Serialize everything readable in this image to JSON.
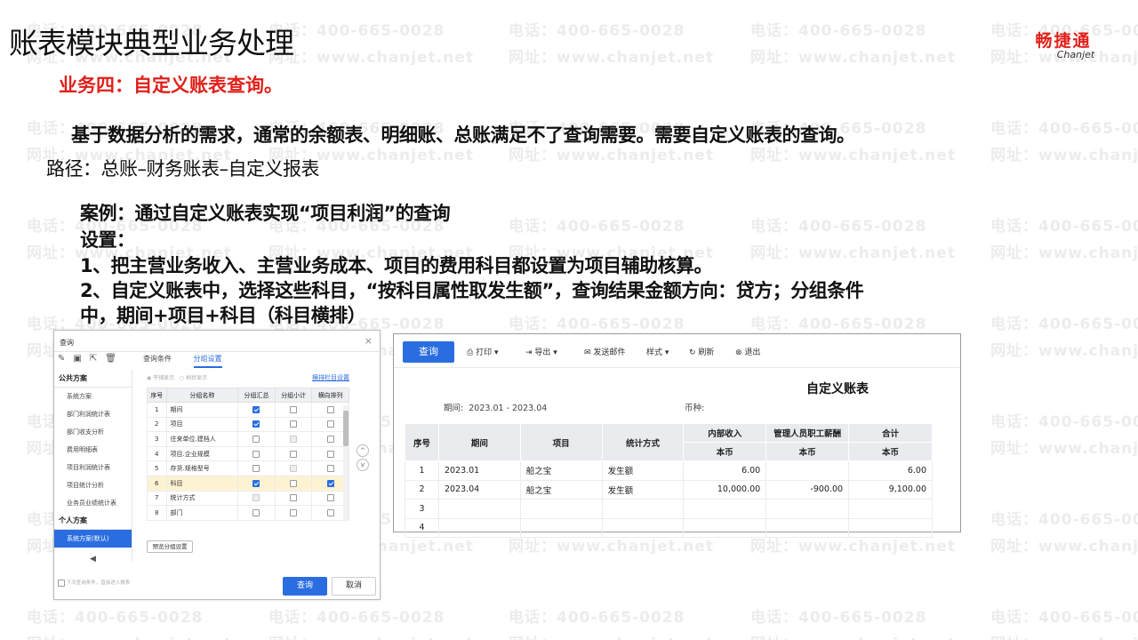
{
  "slide": {
    "title": "账表模块典型业务处理",
    "logo_cn": "畅捷通",
    "logo_en": "Chanjet",
    "section": "业务四：自定义账表查询。",
    "intro": "基于数据分析的需求，通常的余额表、明细账、总账满足不了查询需要。需要自定义账表的查询。",
    "path": "路径：总账–财务账表–自定义报表",
    "case": "案例：通过自定义账表实现“项目利润”的查询",
    "settings": "设置：",
    "step1": "1、把主营业务收入、主营业务成本、项目的费用科目都设置为项目辅助核算。",
    "step2a": "2、自定义账表中，选择这些科目，“按科目属性取发生额”，查询结果金额方向：贷方；分组条件",
    "step2b": "中，期间+项目+科目（科目横排）",
    "watermark_phone": "电话：400-665-0028",
    "watermark_site": "网址：www.chanjet.net"
  },
  "dialog": {
    "title": "查询",
    "close": "×",
    "sidebar": [
      {
        "label": "公共方案",
        "type": "group"
      },
      {
        "label": "系统方案",
        "type": "item"
      },
      {
        "label": "部门利润统计表",
        "type": "item"
      },
      {
        "label": "部门收支分析",
        "type": "item"
      },
      {
        "label": "费用明细表",
        "type": "item"
      },
      {
        "label": "项目利润统计表",
        "type": "item"
      },
      {
        "label": "项目统计分析",
        "type": "item"
      },
      {
        "label": "业务员业绩统计表",
        "type": "item"
      },
      {
        "label": "个人方案",
        "type": "group"
      },
      {
        "label": "系统方案(默认)",
        "type": "selected"
      }
    ],
    "tab_conditions": "查询条件",
    "tab_grouping": "分组设置",
    "opt_flat": "平铺显示",
    "opt_tree": "树状显示",
    "link_cols": "横排栏目设置",
    "columns": [
      "序号",
      "分组名称",
      "分组汇总",
      "分组小计",
      "横向排列"
    ],
    "rows": [
      {
        "no": "1",
        "name": "期间",
        "sum": "ck",
        "sub": "",
        "hor": ""
      },
      {
        "no": "2",
        "name": "项目",
        "sum": "ck",
        "sub": "",
        "hor": ""
      },
      {
        "no": "3",
        "name": "往来单位.建档人",
        "sum": "",
        "sub": "dis",
        "hor": ""
      },
      {
        "no": "4",
        "name": "项目.企业规模",
        "sum": "",
        "sub": "",
        "hor": ""
      },
      {
        "no": "5",
        "name": "存货.规格型号",
        "sum": "",
        "sub": "dis",
        "hor": ""
      },
      {
        "no": "6",
        "name": "科目",
        "sum": "ck",
        "sub": "",
        "hor": "ck",
        "hl": true
      },
      {
        "no": "7",
        "name": "统计方式",
        "sum": "dis",
        "sub": "",
        "hor": ""
      },
      {
        "no": "8",
        "name": "部门",
        "sum": "",
        "sub": "",
        "hor": ""
      }
    ],
    "preview_btn": "预览分组设置",
    "footer_note": "下次查询条件，直接进入报表",
    "ok": "查询",
    "cancel": "取消",
    "nav_up": "^",
    "nav_down": "v",
    "nav_back": "◀"
  },
  "report": {
    "toolbar": {
      "query": "查询",
      "print": "打印",
      "export": "导出",
      "email": "发送邮件",
      "style": "样式",
      "refresh": "刷新",
      "exit": "退出"
    },
    "title": "自定义账表",
    "period_label": "期间:",
    "period_value": "2023.01 - 2023.04",
    "currency_label": "币种:",
    "headers": {
      "no": "序号",
      "period": "期间",
      "project": "项目",
      "stat": "统计方式",
      "income": "内部收入",
      "salary": "管理人员职工薪酬",
      "total": "合计",
      "currency": "本币"
    },
    "rows": [
      {
        "no": "1",
        "period": "2023.01",
        "project": "船之宝",
        "stat": "发生额",
        "income": "6.00",
        "salary": "",
        "total": "6.00"
      },
      {
        "no": "2",
        "period": "2023.04",
        "project": "船之宝",
        "stat": "发生额",
        "income": "10,000.00",
        "salary": "-900.00",
        "total": "9,100.00"
      },
      {
        "no": "3",
        "period": "",
        "project": "",
        "stat": "",
        "income": "",
        "salary": "",
        "total": ""
      },
      {
        "no": "4",
        "period": "",
        "project": "",
        "stat": "",
        "income": "",
        "salary": "",
        "total": ""
      }
    ],
    "negative_color": "#e0201a",
    "accent": "#2a6de0"
  }
}
